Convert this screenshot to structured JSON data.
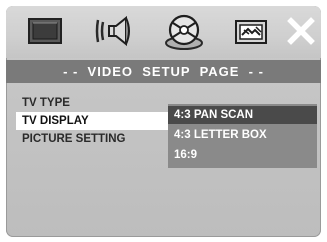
{
  "header": {
    "icons": [
      {
        "name": "tv-screen-icon"
      },
      {
        "name": "speaker-sound-icon"
      },
      {
        "name": "disc-icon"
      },
      {
        "name": "picture-settings-icon"
      },
      {
        "name": "close-icon"
      }
    ]
  },
  "page_title": "- -  VIDEO  SETUP  PAGE  - -",
  "menu": {
    "items": [
      {
        "label": "TV TYPE"
      },
      {
        "label": "TV DISPLAY"
      },
      {
        "label": "PICTURE SETTING"
      }
    ],
    "selected": "TV DISPLAY"
  },
  "submenu": {
    "options": [
      {
        "label": "4:3 PAN SCAN"
      },
      {
        "label": "4:3 LETTER BOX"
      },
      {
        "label": "16:9"
      }
    ],
    "highlighted": "4:3 PAN SCAN"
  },
  "colors": {
    "background": "#c4c4c4",
    "title_bar": "#7a7a7a",
    "submenu_bg": "#8a8a8a",
    "submenu_highlight": "#4a4a4a",
    "selected_item_bg": "#ffffff"
  }
}
